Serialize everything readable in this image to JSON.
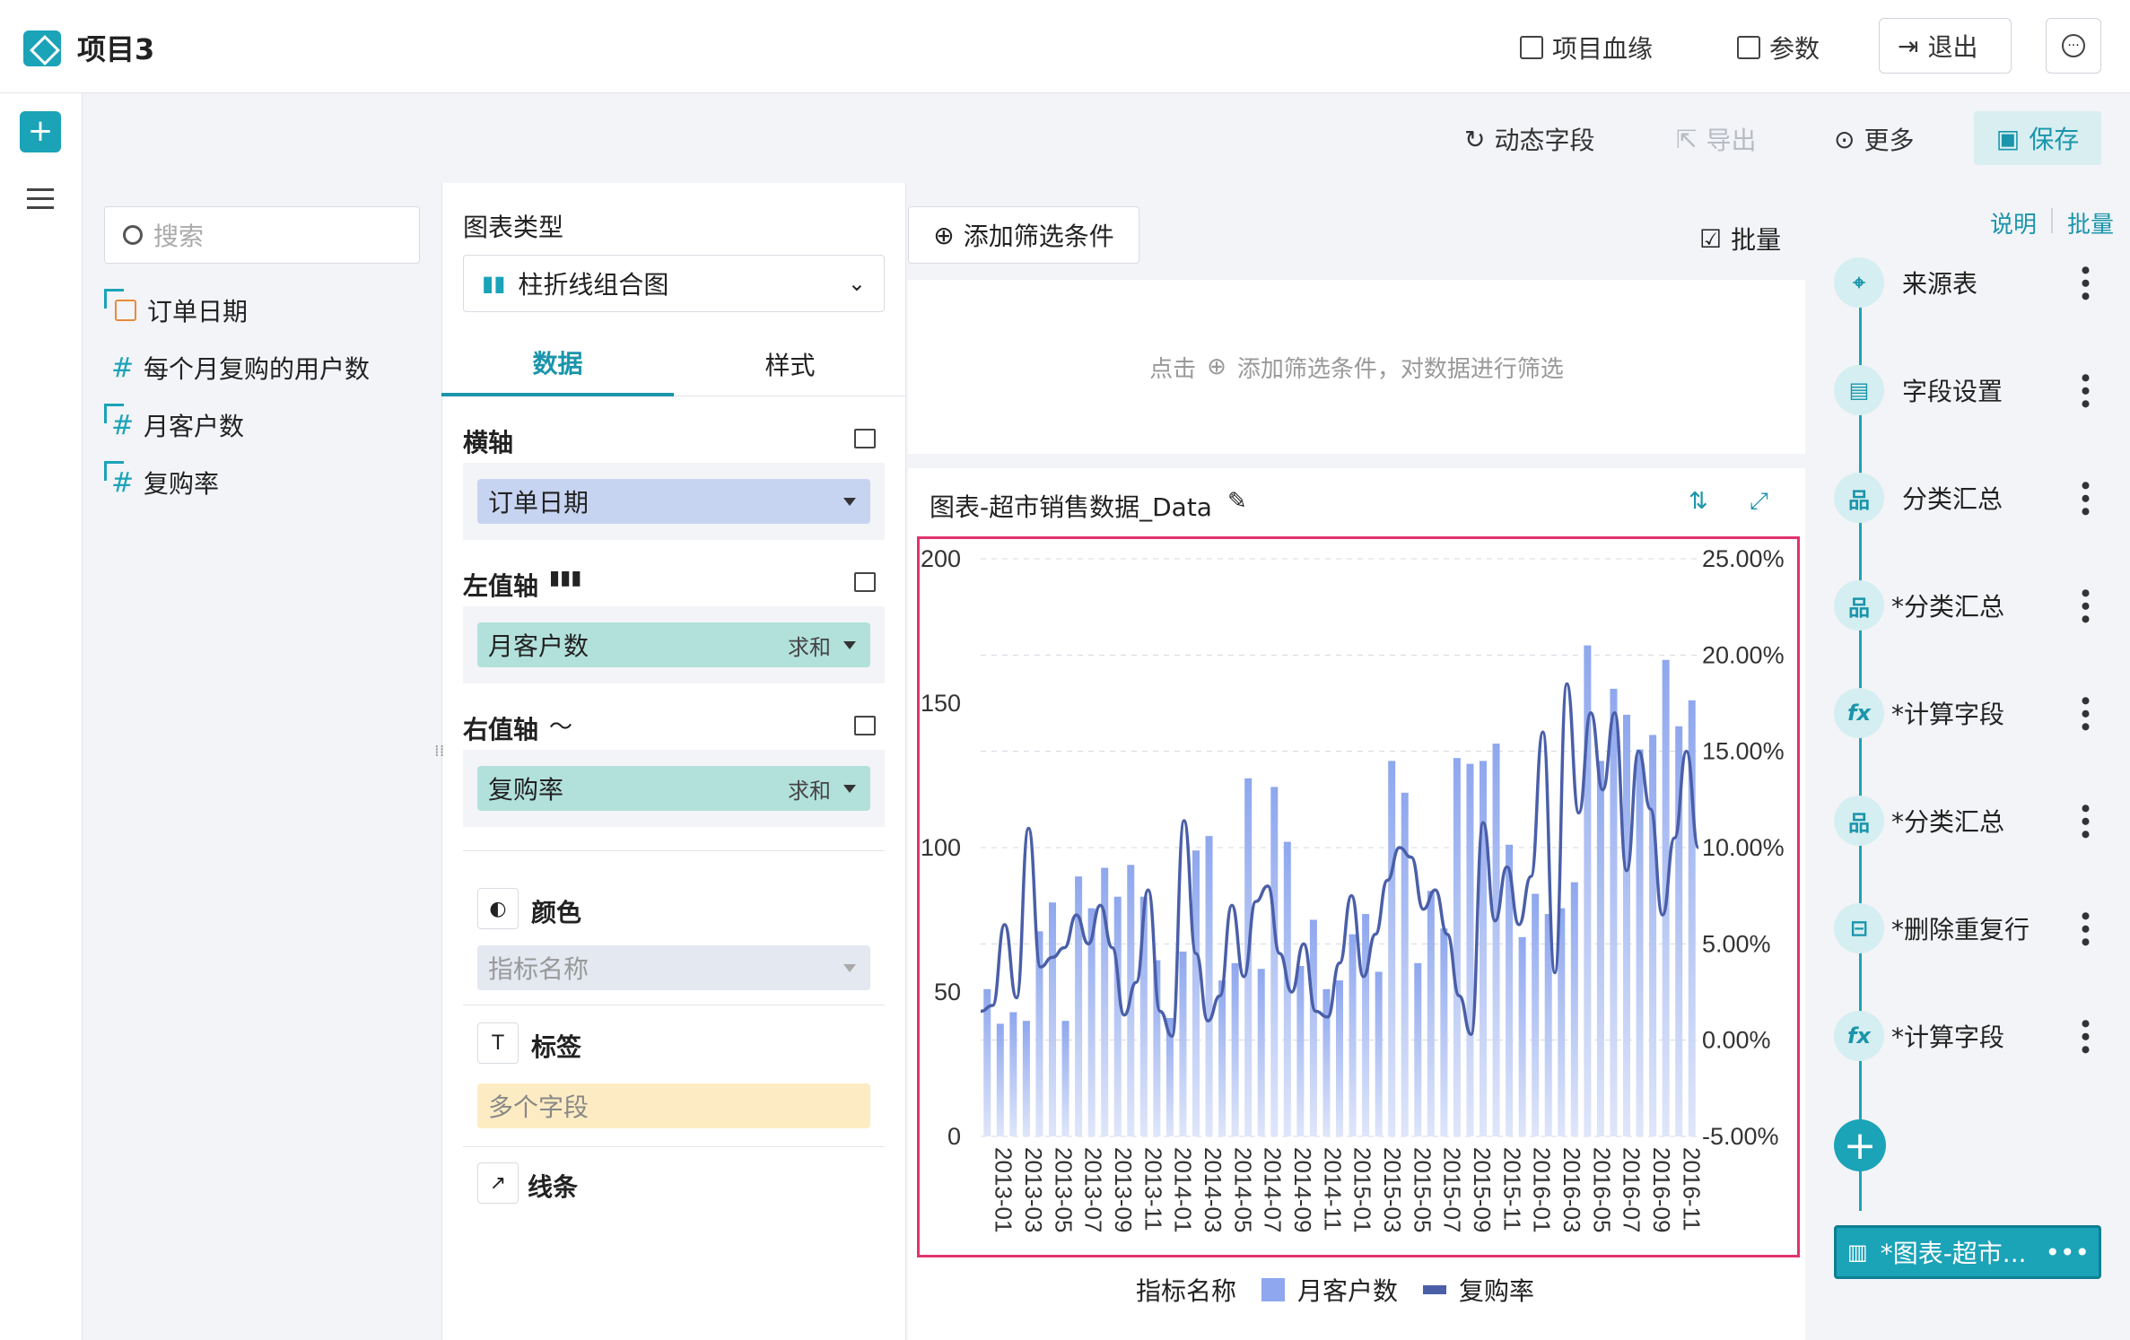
{
  "app": {
    "title": "项目3"
  },
  "topbar": {
    "lineage": "项目血缘",
    "params": "参数",
    "exit": "退出"
  },
  "toolbar": {
    "dynamic": "动态字段",
    "export": "导出",
    "more": "更多",
    "save": "保存"
  },
  "fields": {
    "search_placeholder": "搜索",
    "items": [
      "订单日期",
      "每个月复购的用户数",
      "月客户数",
      "复购率"
    ]
  },
  "config": {
    "chart_type_label": "图表类型",
    "chart_type_value": "柱折线组合图",
    "tabs": [
      "数据",
      "样式"
    ],
    "x_axis": {
      "label": "横轴",
      "field": "订单日期"
    },
    "left_axis": {
      "label": "左值轴",
      "field": "月客户数",
      "agg": "求和"
    },
    "right_axis": {
      "label": "右值轴",
      "field": "复购率",
      "agg": "求和"
    },
    "color": {
      "label": "颜色",
      "value": "指标名称"
    },
    "tag": {
      "label": "标签",
      "value": "多个字段"
    },
    "line": {
      "label": "线条"
    }
  },
  "filter": {
    "add_button": "添加筛选条件",
    "batch": "批量",
    "hint_prefix": "点击",
    "hint_text": "添加筛选条件，对数据进行筛选"
  },
  "chart_card": {
    "title": "图表-超市销售数据_Data"
  },
  "legend": {
    "title": "指标名称",
    "bar": "月客户数",
    "line": "复购率"
  },
  "pipeline": {
    "explain": "说明",
    "batch": "批量",
    "nodes": [
      "来源表",
      "字段设置",
      "分类汇总",
      "*分类汇总",
      "*计算字段",
      "*分类汇总",
      "*删除重复行",
      "*计算字段"
    ],
    "active": "*图表-超市..."
  },
  "colors": {
    "accent": "#1ba3b8",
    "bar": "#8ea7ee",
    "line": "#4a5fa8",
    "highlight": "#e1336e"
  },
  "chart_data": {
    "type": "bar",
    "x_ticks": [
      "2013-01",
      "2013-03",
      "2013-05",
      "2013-07",
      "2013-09",
      "2013-11",
      "2014-01",
      "2014-03",
      "2014-05",
      "2014-07",
      "2014-09",
      "2014-11",
      "2015-01",
      "2015-03",
      "2015-05",
      "2015-07",
      "2015-09",
      "2015-11",
      "2016-01",
      "2016-03",
      "2016-05",
      "2016-07",
      "2016-09",
      "2016-11"
    ],
    "yleft_ticks": [
      "0",
      "50",
      "100",
      "150",
      "200"
    ],
    "yright_ticks": [
      "-5.00%",
      "0.00%",
      "5.00%",
      "10.00%",
      "15.00%",
      "20.00%",
      "25.00%"
    ],
    "ylim_left": [
      0,
      200
    ],
    "ylim_right": [
      -5,
      25
    ],
    "bar_series": {
      "name": "月客户数",
      "values": [
        51,
        39,
        43,
        40,
        71,
        81,
        40,
        90,
        79,
        93,
        83,
        94,
        83,
        61,
        41,
        64,
        99,
        104,
        54,
        60,
        124,
        58,
        121,
        102,
        59,
        75,
        51,
        54,
        70,
        77,
        57,
        130,
        119,
        60,
        85,
        72,
        131,
        129,
        130,
        136,
        101,
        69,
        84,
        77,
        79,
        88,
        170,
        130,
        155,
        146,
        134,
        139,
        165,
        142,
        151
      ]
    },
    "line_series": {
      "name": "复购率",
      "values": [
        1.5,
        1.8,
        6.0,
        2.2,
        11.0,
        3.8,
        4.3,
        4.8,
        6.5,
        5.0,
        7.0,
        4.8,
        1.3,
        3.0,
        7.8,
        1.5,
        0.2,
        11.4,
        4.5,
        1.0,
        2.3,
        7.0,
        3.3,
        7.2,
        8.0,
        4.5,
        2.5,
        5.0,
        1.5,
        1.2,
        4.0,
        7.5,
        3.3,
        5.5,
        8.3,
        10.0,
        9.5,
        6.8,
        7.8,
        5.5,
        2.3,
        0.3,
        11.3,
        6.2,
        9.0,
        6.0,
        8.5,
        16.0,
        3.5,
        18.5,
        11.8,
        17.0,
        13.0,
        17.0,
        8.8,
        15.0,
        12.0,
        6.5,
        10.5,
        15.0,
        10.0
      ]
    }
  }
}
